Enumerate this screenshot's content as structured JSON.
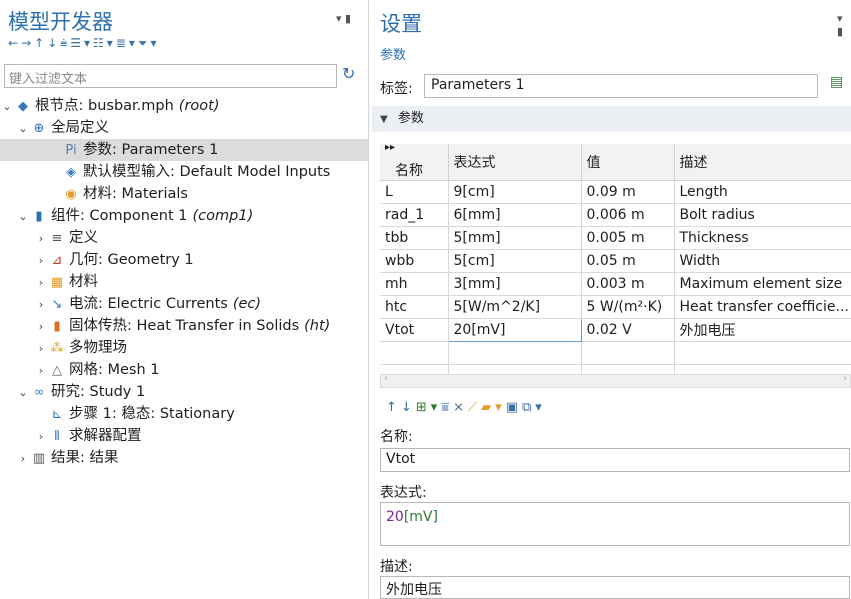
{
  "left": {
    "title": "模型开发器",
    "filter_placeholder": "键入过滤文本",
    "tree": [
      {
        "text": "根节点: busbar.mph",
        "tag": "(root)",
        "expander": "v",
        "icon": "◆",
        "color": "#3a78c2"
      },
      {
        "text": "全局定义",
        "expander": "v",
        "icon": "⊕",
        "color": "#2b6fb5"
      },
      {
        "text": "参数: Parameters 1",
        "icon": "Pi",
        "color": "#5b7fb0",
        "selected": true
      },
      {
        "text": "默认模型输入: Default Model Inputs",
        "icon": "◈",
        "color": "#3a78c2"
      },
      {
        "text": "材料: Materials",
        "icon": "◉",
        "color": "#e39b28"
      },
      {
        "text": "组件: Component 1",
        "tag": "(comp1)",
        "expander": "v",
        "icon": "▮",
        "color": "#2b6fb5"
      },
      {
        "text": "定义",
        "expander": ">",
        "icon": "≡",
        "color": "#555"
      },
      {
        "text": "几何: Geometry 1",
        "expander": ">",
        "icon": "⊿",
        "color": "#c0392b"
      },
      {
        "text": "材料",
        "expander": ">",
        "icon": "▦",
        "color": "#e39b28"
      },
      {
        "text": "电流: Electric Currents",
        "tag": "(ec)",
        "expander": ">",
        "icon": "↘",
        "color": "#3a78c2"
      },
      {
        "text": "固体传热: Heat Transfer in Solids",
        "tag": "(ht)",
        "expander": ">",
        "icon": "▮",
        "color": "#e06a1e"
      },
      {
        "text": "多物理场",
        "expander": ">",
        "icon": "⁂",
        "color": "#d4a020"
      },
      {
        "text": "网格: Mesh 1",
        "expander": ">",
        "icon": "△",
        "color": "#666"
      },
      {
        "text": "研究: Study 1",
        "expander": "v",
        "icon": "∞",
        "color": "#3a78c2"
      },
      {
        "text": "步骤 1: 稳态: Stationary",
        "icon": "⊾",
        "color": "#3a78c2"
      },
      {
        "text": "求解器配置",
        "expander": ">",
        "icon": "⫴",
        "color": "#3a78c2"
      },
      {
        "text": "结果: 结果",
        "expander": ">",
        "icon": "▥",
        "color": "#555"
      }
    ]
  },
  "right": {
    "title": "设置",
    "subtitle": "参数",
    "label_caption": "标签:",
    "label_value": "Parameters 1",
    "section": "参数",
    "table": {
      "headers": [
        "名称",
        "表达式",
        "值",
        "描述"
      ],
      "rows": [
        [
          "L",
          "9[cm]",
          "0.09 m",
          "Length"
        ],
        [
          "rad_1",
          "6[mm]",
          "0.006 m",
          "Bolt radius"
        ],
        [
          "tbb",
          "5[mm]",
          "0.005 m",
          "Thickness"
        ],
        [
          "wbb",
          "5[cm]",
          "0.05 m",
          "Width"
        ],
        [
          "mh",
          "3[mm]",
          "0.003 m",
          "Maximum element size"
        ],
        [
          "htc",
          "5[W/m^2/K]",
          "5 W/(m²·K)",
          "Heat transfer coefficie..."
        ],
        [
          "Vtot",
          "20[mV]",
          "0.02 V",
          "外加电压"
        ]
      ]
    },
    "name_caption": "名称:",
    "name_value": "Vtot",
    "expr_caption": "表达式:",
    "expr_number": "20",
    "expr_unit": "[mV]",
    "desc_caption": "描述:",
    "desc_value": "外加电压"
  }
}
